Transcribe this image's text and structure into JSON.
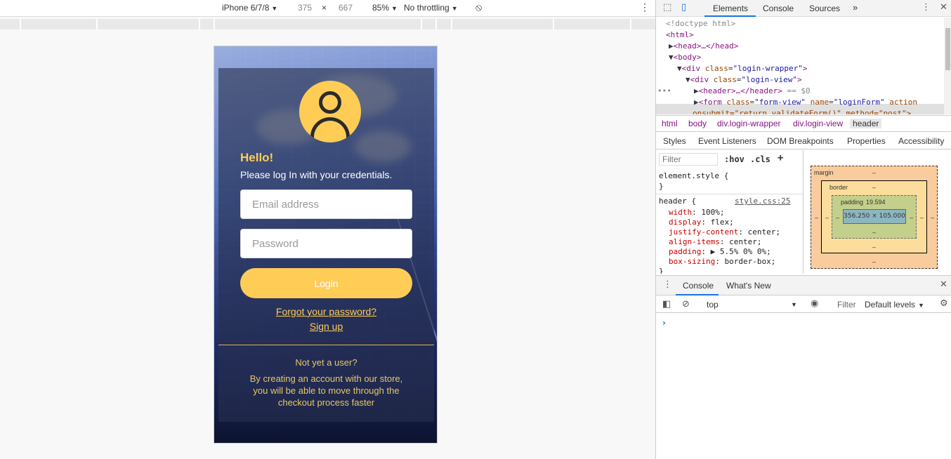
{
  "emulation": {
    "device": "iPhone 6/7/8",
    "width": "375",
    "times": "×",
    "height": "667",
    "zoom": "85%",
    "throttling": "No throttling"
  },
  "login": {
    "hello": "Hello!",
    "subtitle": "Please log In with your credentials.",
    "email_placeholder": "Email address",
    "password_placeholder": "Password",
    "login_label": "Login",
    "forgot_label": "Forgot your password?",
    "signup_label": "Sign up",
    "not_yet": "Not yet a user?",
    "create_msg": "By creating an account with our store, you will be able to move through the checkout process faster",
    "accent_color": "#ffcd56"
  },
  "devtools": {
    "tabs": [
      "Elements",
      "Console",
      "Sources",
      "»"
    ],
    "dom": {
      "l1": "<!doctype html>",
      "l2_tag": "<html>",
      "l3": "<head>…</head>",
      "l4": "<body>",
      "l5_tag": "<div",
      "l5_attr": "class",
      "l5_val": "\"login-wrapper\"",
      "l6_tag": "<div",
      "l6_attr": "class",
      "l6_val": "\"login-view\"",
      "l7": "<header>…</header>",
      "l7_eq": "== $0",
      "l8_tag": "<form",
      "l8_attr1": "class",
      "l8_val1": "\"form-view\"",
      "l8_attr2": "name",
      "l8_val2": "\"loginForm\"",
      "l8_attr3": "action",
      "l9": "onsubmit=\"return validateForm()\" method=\"post\">"
    },
    "breadcrumbs": [
      "html",
      "body",
      "div.login-wrapper",
      "div.login-view",
      "header"
    ],
    "sub_tabs": [
      "Styles",
      "Event Listeners",
      "DOM Breakpoints",
      "Properties",
      "Accessibility"
    ],
    "styles": {
      "filter_placeholder": "Filter",
      "hov": ":hov",
      "cls": ".cls",
      "plus": "+",
      "element_style": "element.style {",
      "close1": "}",
      "header_rule": "header {",
      "source": "style.css:25",
      "props": [
        {
          "name": "width",
          "value": "100%;"
        },
        {
          "name": "display",
          "value": "flex;"
        },
        {
          "name": "justify-content",
          "value": "center;"
        },
        {
          "name": "align-items",
          "value": "center;"
        },
        {
          "name": "padding",
          "value": "▶ 5.5% 0% 0%;"
        },
        {
          "name": "box-sizing",
          "value": "border-box;"
        }
      ],
      "close2": "}"
    },
    "box_model": {
      "margin": "margin",
      "border": "border",
      "padding": "padding",
      "padding_top": "19.594",
      "content": "356.250 × 105.000",
      "dash": "–"
    },
    "drawer_tabs": [
      "Console",
      "What's New"
    ],
    "console": {
      "context": "top",
      "filter": "Filter",
      "levels": "Default levels",
      "prompt": "›"
    }
  }
}
